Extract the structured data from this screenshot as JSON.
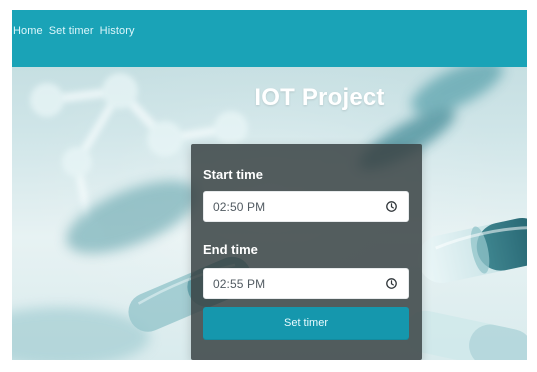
{
  "nav": {
    "items": [
      {
        "label": "Home"
      },
      {
        "label": "Set timer"
      },
      {
        "label": "History"
      }
    ]
  },
  "hero": {
    "title": "IOT Project"
  },
  "timer": {
    "start_label": "Start time",
    "start_value": "02:50 PM",
    "end_label": "End time",
    "end_value": "02:55 PM",
    "button_label": "Set timer"
  },
  "icons": {
    "start_time_icon": "clock-icon",
    "end_time_icon": "clock-icon"
  },
  "colors": {
    "navbar": "#1aa3b7",
    "card": "#3a4345",
    "button": "#1597ad",
    "page_background": "#d9ebed"
  }
}
